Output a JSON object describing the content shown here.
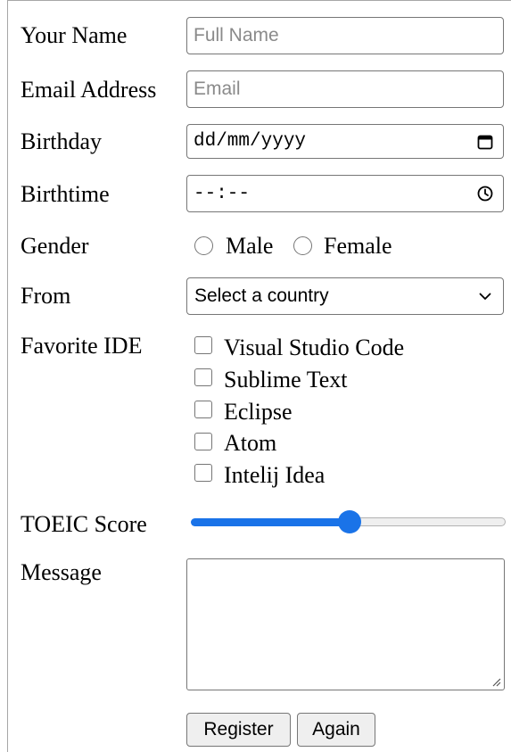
{
  "form": {
    "name": {
      "label": "Your Name",
      "placeholder": "Full Name"
    },
    "email": {
      "label": "Email Address",
      "placeholder": "Email"
    },
    "birthday": {
      "label": "Birthday",
      "value": "dd/mm/yyyy",
      "icon": "calendar-icon"
    },
    "birthtime": {
      "label": "Birthtime",
      "value": "--:--",
      "icon": "clock-icon"
    },
    "gender": {
      "label": "Gender",
      "options": [
        "Male",
        "Female"
      ]
    },
    "from": {
      "label": "From",
      "selected": "Select a country",
      "icon": "chevron-down-icon"
    },
    "favorite_ide": {
      "label": "Favorite IDE",
      "options": [
        "Visual Studio Code",
        "Sublime Text",
        "Eclipse",
        "Atom",
        "Intelij Idea"
      ]
    },
    "toeic": {
      "label": "TOEIC Score",
      "value_fraction": 0.5,
      "accent": "#1a73e8"
    },
    "message": {
      "label": "Message",
      "value": ""
    },
    "buttons": {
      "register": "Register",
      "again": "Again"
    }
  }
}
